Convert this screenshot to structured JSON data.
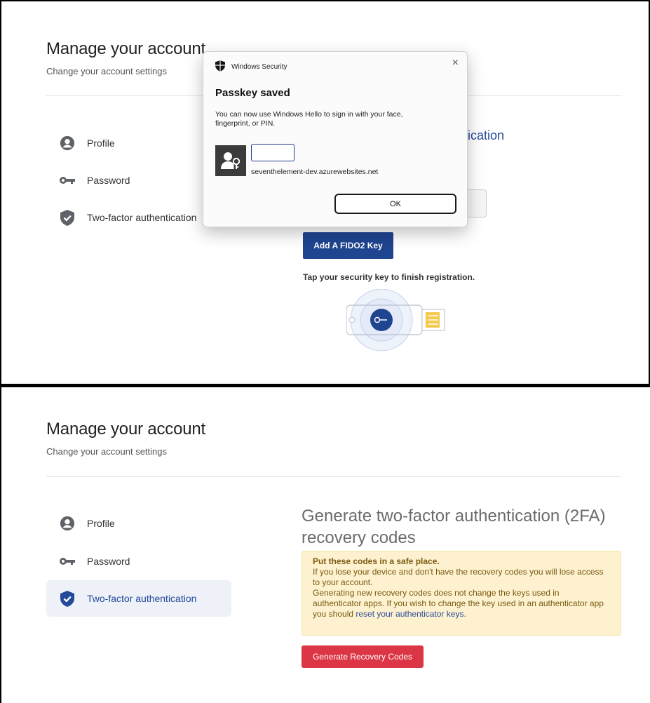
{
  "top": {
    "page_title": "Manage your account",
    "page_subtitle": "Change your account settings",
    "nav": [
      {
        "label": "Profile",
        "icon": "profile-icon"
      },
      {
        "label": "Password",
        "icon": "key-icon"
      },
      {
        "label": "Two-factor authentication",
        "icon": "shield-check-icon"
      }
    ],
    "section_heading_partial": "tication",
    "fido_button": "Add A FIDO2 Key",
    "tap_text": "Tap your security key to finish registration."
  },
  "dialog": {
    "app_name": "Windows Security",
    "heading": "Passkey saved",
    "body": "You can now use Windows Hello to sign in with your face, fingerprint, or PIN.",
    "username": "",
    "site": "seventhelement-dev.azurewebsites.net",
    "ok_label": "OK",
    "close_label": "×"
  },
  "bottom": {
    "page_title": "Manage your account",
    "page_subtitle": "Change your account settings",
    "nav": [
      {
        "label": "Profile",
        "icon": "profile-icon",
        "active": false
      },
      {
        "label": "Password",
        "icon": "key-icon",
        "active": false
      },
      {
        "label": "Two-factor authentication",
        "icon": "shield-check-icon",
        "active": true
      }
    ],
    "heading": "Generate two-factor authentication (2FA) recovery codes",
    "warning": {
      "title": "Put these codes in a safe place.",
      "line1": "If you lose your device and don't have the recovery codes you will lose access to your account.",
      "line2_prefix": "Generating new recovery codes does not change the keys used in authenticator apps. If you wish to change the key used in an authenticator app you should ",
      "link": "reset your authenticator keys",
      "line2_suffix": "."
    },
    "generate_button": "Generate Recovery Codes"
  },
  "colors": {
    "primary_blue": "#1f4490",
    "heading_blue": "#234a9a",
    "danger_red": "#dc3545",
    "warning_bg": "#fdf1cf",
    "active_nav_bg": "#eef1f7"
  }
}
